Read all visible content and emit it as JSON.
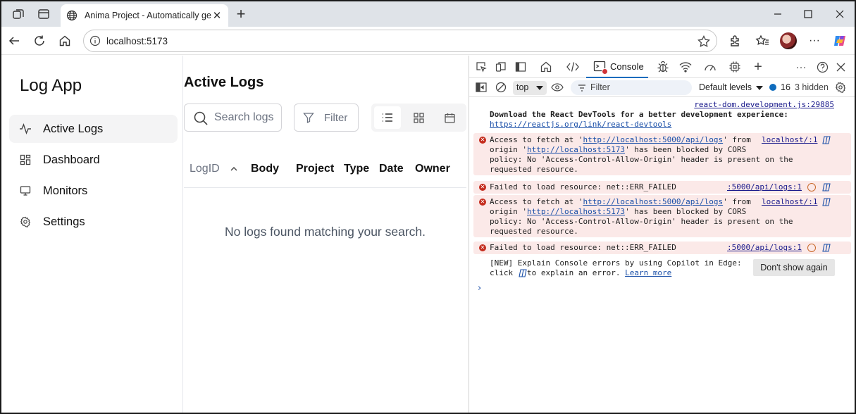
{
  "browser": {
    "tab_title": "Anima Project - Automatically ge",
    "url": "localhost:5173"
  },
  "app": {
    "logo": "Log App",
    "sidebar": {
      "items": [
        {
          "label": "Active Logs",
          "icon": "activity-icon",
          "active": true
        },
        {
          "label": "Dashboard",
          "icon": "dashboard-grid-icon",
          "active": false
        },
        {
          "label": "Monitors",
          "icon": "monitor-icon",
          "active": false
        },
        {
          "label": "Settings",
          "icon": "gear-icon",
          "active": false
        }
      ]
    },
    "main": {
      "title": "Active Logs",
      "search_placeholder": "Search logs",
      "filter_label": "Filter",
      "views": [
        "list-view-icon",
        "grid-view-icon",
        "calendar-view-icon"
      ],
      "columns": [
        "LogID",
        "Body",
        "Project",
        "Type",
        "Date",
        "Owner"
      ],
      "empty_message": "No logs found matching your search."
    }
  },
  "devtools": {
    "console_tab": "Console",
    "context": "top",
    "filter_placeholder": "Filter",
    "levels": "Default levels",
    "issues_count": "16",
    "hidden": "3 hidden",
    "messages": {
      "m0_src": "react-dom.development.js:29885",
      "m0_line1": "Download the React DevTools for a better development experience:",
      "m0_link": "https://reactjs.org/link/react-devtools",
      "e1_a": "Access to fetch at '",
      "e1_link1": "http://localhost:5000/api/logs",
      "e1_b": "' from",
      "e1_c": "origin '",
      "e1_link2": "http://localhost:5173",
      "e1_d": "' has been blocked by CORS",
      "e1_e": "policy: No 'Access-Control-Allow-Origin' header is present on the",
      "e1_f": "requested resource.",
      "e1_src": "localhost/:1",
      "e2": "Failed to load resource: net::ERR_FAILED",
      "e2_src": ":5000/api/logs:1",
      "tip_a": "[NEW] Explain Console errors by using Copilot in Edge:",
      "tip_b": "click",
      "tip_c": "to explain an error.",
      "tip_link": "Learn more",
      "dont_show": "Don't show again"
    }
  },
  "colors": {
    "accent": "#0f6cbd",
    "error_bg": "#fbe9e8",
    "error_red": "#c42b1c"
  }
}
